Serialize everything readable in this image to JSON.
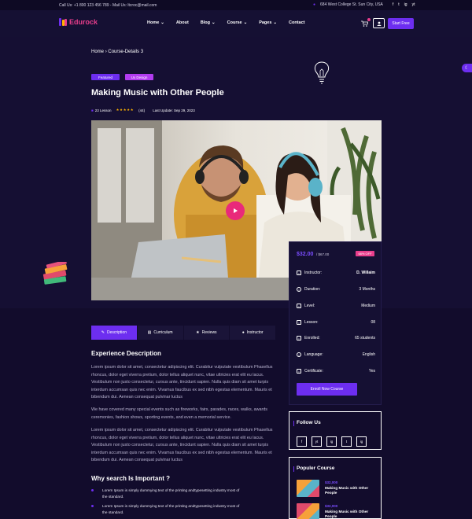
{
  "topbar": {
    "call": "Call Us: +1 800 123 456 789",
    "mail": "Mail Us: ltcroc@mail.com",
    "address": "684 West College St. Sun City, USA",
    "social": [
      "f",
      "t",
      "ig",
      "yt"
    ]
  },
  "header": {
    "logo": "Edurock",
    "nav": [
      "Home",
      "About",
      "Blog",
      "Course",
      "Pages",
      "Contact"
    ],
    "start_button": "Start Free"
  },
  "breadcrumb": {
    "home": "Home",
    "separator": "›",
    "current": "Course-Details 3"
  },
  "badges": {
    "featured": "Featured",
    "category": "Ux Design"
  },
  "course": {
    "title": "Making Music with Other People",
    "lessons": "23 Lesson",
    "rating_count": "(44)",
    "last_update": "Last Update: Sep 29, 2023"
  },
  "sidebar": {
    "price": "$32.00",
    "old_price": "/ $67.00",
    "discount": "68% OFF",
    "rows": [
      {
        "label": "Instructor:",
        "value": "D. Willaim",
        "icon": "user-icon"
      },
      {
        "label": "Duration:",
        "value": "3 Months",
        "icon": "clock-icon"
      },
      {
        "label": "Level:",
        "value": "Medium",
        "icon": "level-icon"
      },
      {
        "label": "Lesson:",
        "value": "08",
        "icon": "book-icon"
      },
      {
        "label": "Enrolled:",
        "value": "65 students",
        "icon": "graduation-icon"
      },
      {
        "label": "Language:",
        "value": "English",
        "icon": "globe-icon"
      },
      {
        "label": "Certificate:",
        "value": "Yes",
        "icon": "certificate-icon"
      }
    ],
    "enroll_button": "Enroll Now Course"
  },
  "tabs": [
    "Description",
    "Curriculum",
    "Reviews",
    "Instructor"
  ],
  "description": {
    "heading": "Experience Description",
    "p1": "Lorem ipsum dolor sit amet, consectetur adipiscing elit. Curabitur vulputate vestibulum Phasellus rhoncus, dolor eget viverra pretium, dolor tellus aliquet nunc, vitae ultricies erat elit eu lacus. Vestibulum non justo consectetur, cursus ante, tincidunt sapien. Nulla quis diam sit amet turpis interdum accumsan quis nec enim. Vivamus faucibus ex sed nibh egestas elementum. Mauris et bibendum dui. Aenean consequat pulvinar luctus",
    "p2": "We have covered many special events such as fireworks, fairs, parades, races, walks, awards ceremonies, fashion shows, sporting events, and even a memorial service.",
    "p3": "Lorem ipsum dolor sit amet, consectetur adipiscing elit. Curabitur vulputate vestibulum Phasellus rhoncus, dolor eget viverra pretium, dolor tellus aliquet nunc, vitae ultricies erat elit eu lacus. Vestibulum non justo consectetur, cursus ante, tincidunt sapien. Nulla quis diam sit amet turpis interdum accumsan quis nec enim. Vivamus faucibus ex sed nibh egestas elementum. Mauris et bibendum dui. Aenean consequat pulvinar luctus",
    "heading2": "Why search Is Important ?",
    "bullets": [
      "Lorem Ipsum is simply dummying text of the printing andtypesetting industry most of the standard.",
      "Lorem Ipsum is simply dummying text of the printing andtypesetting industry most of the standard."
    ]
  },
  "follow": {
    "heading": "Follow Us",
    "icons": [
      "f",
      "yt",
      "ig",
      "t",
      "ig"
    ]
  },
  "popular": {
    "heading": "Populer Course",
    "items": [
      {
        "price": "$32,000",
        "title": "Making Music with Other People"
      },
      {
        "price": "$32,000",
        "title": "Making Music with Other People"
      }
    ]
  },
  "colors": {
    "accent": "#6d2ef0",
    "pink": "#e83e8c",
    "background": "#120c2c"
  }
}
